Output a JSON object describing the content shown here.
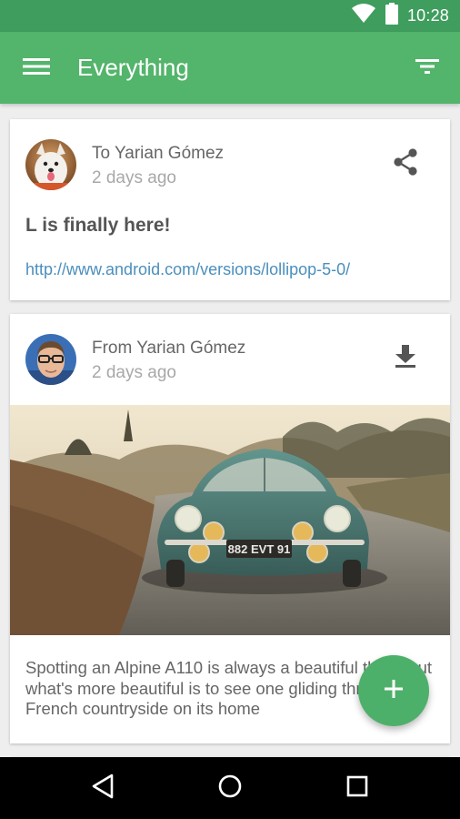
{
  "status_bar": {
    "time": "10:28",
    "icons": [
      "wifi-icon",
      "battery-icon"
    ]
  },
  "app_bar": {
    "title": "Everything",
    "menu_icon": "menu-icon",
    "filter_icon": "filter-icon",
    "color": "#53b46b",
    "status_color": "#3f9d5e"
  },
  "feed": [
    {
      "name": "To Yarian Gómez",
      "time": "2 days ago",
      "avatar": "dog-avatar",
      "action_icon": "share-icon",
      "title": "L is finally here!",
      "link": "http://www.android.com/versions/lollipop-5-0/"
    },
    {
      "name": "From Yarian Gómez",
      "time": "2 days ago",
      "avatar": "man-glasses-avatar",
      "action_icon": "download-icon",
      "image": "vintage-car-photo",
      "plate": "882 EVT 91",
      "body": "Spotting an Alpine A110 is always a beautiful thing, but what's more beautiful is to see one gliding through the French countryside on its home"
    }
  ],
  "fab": {
    "icon": "add-icon",
    "color": "#4db06a"
  },
  "nav_bar": {
    "icons": [
      "back-icon",
      "home-icon",
      "recents-icon"
    ]
  }
}
